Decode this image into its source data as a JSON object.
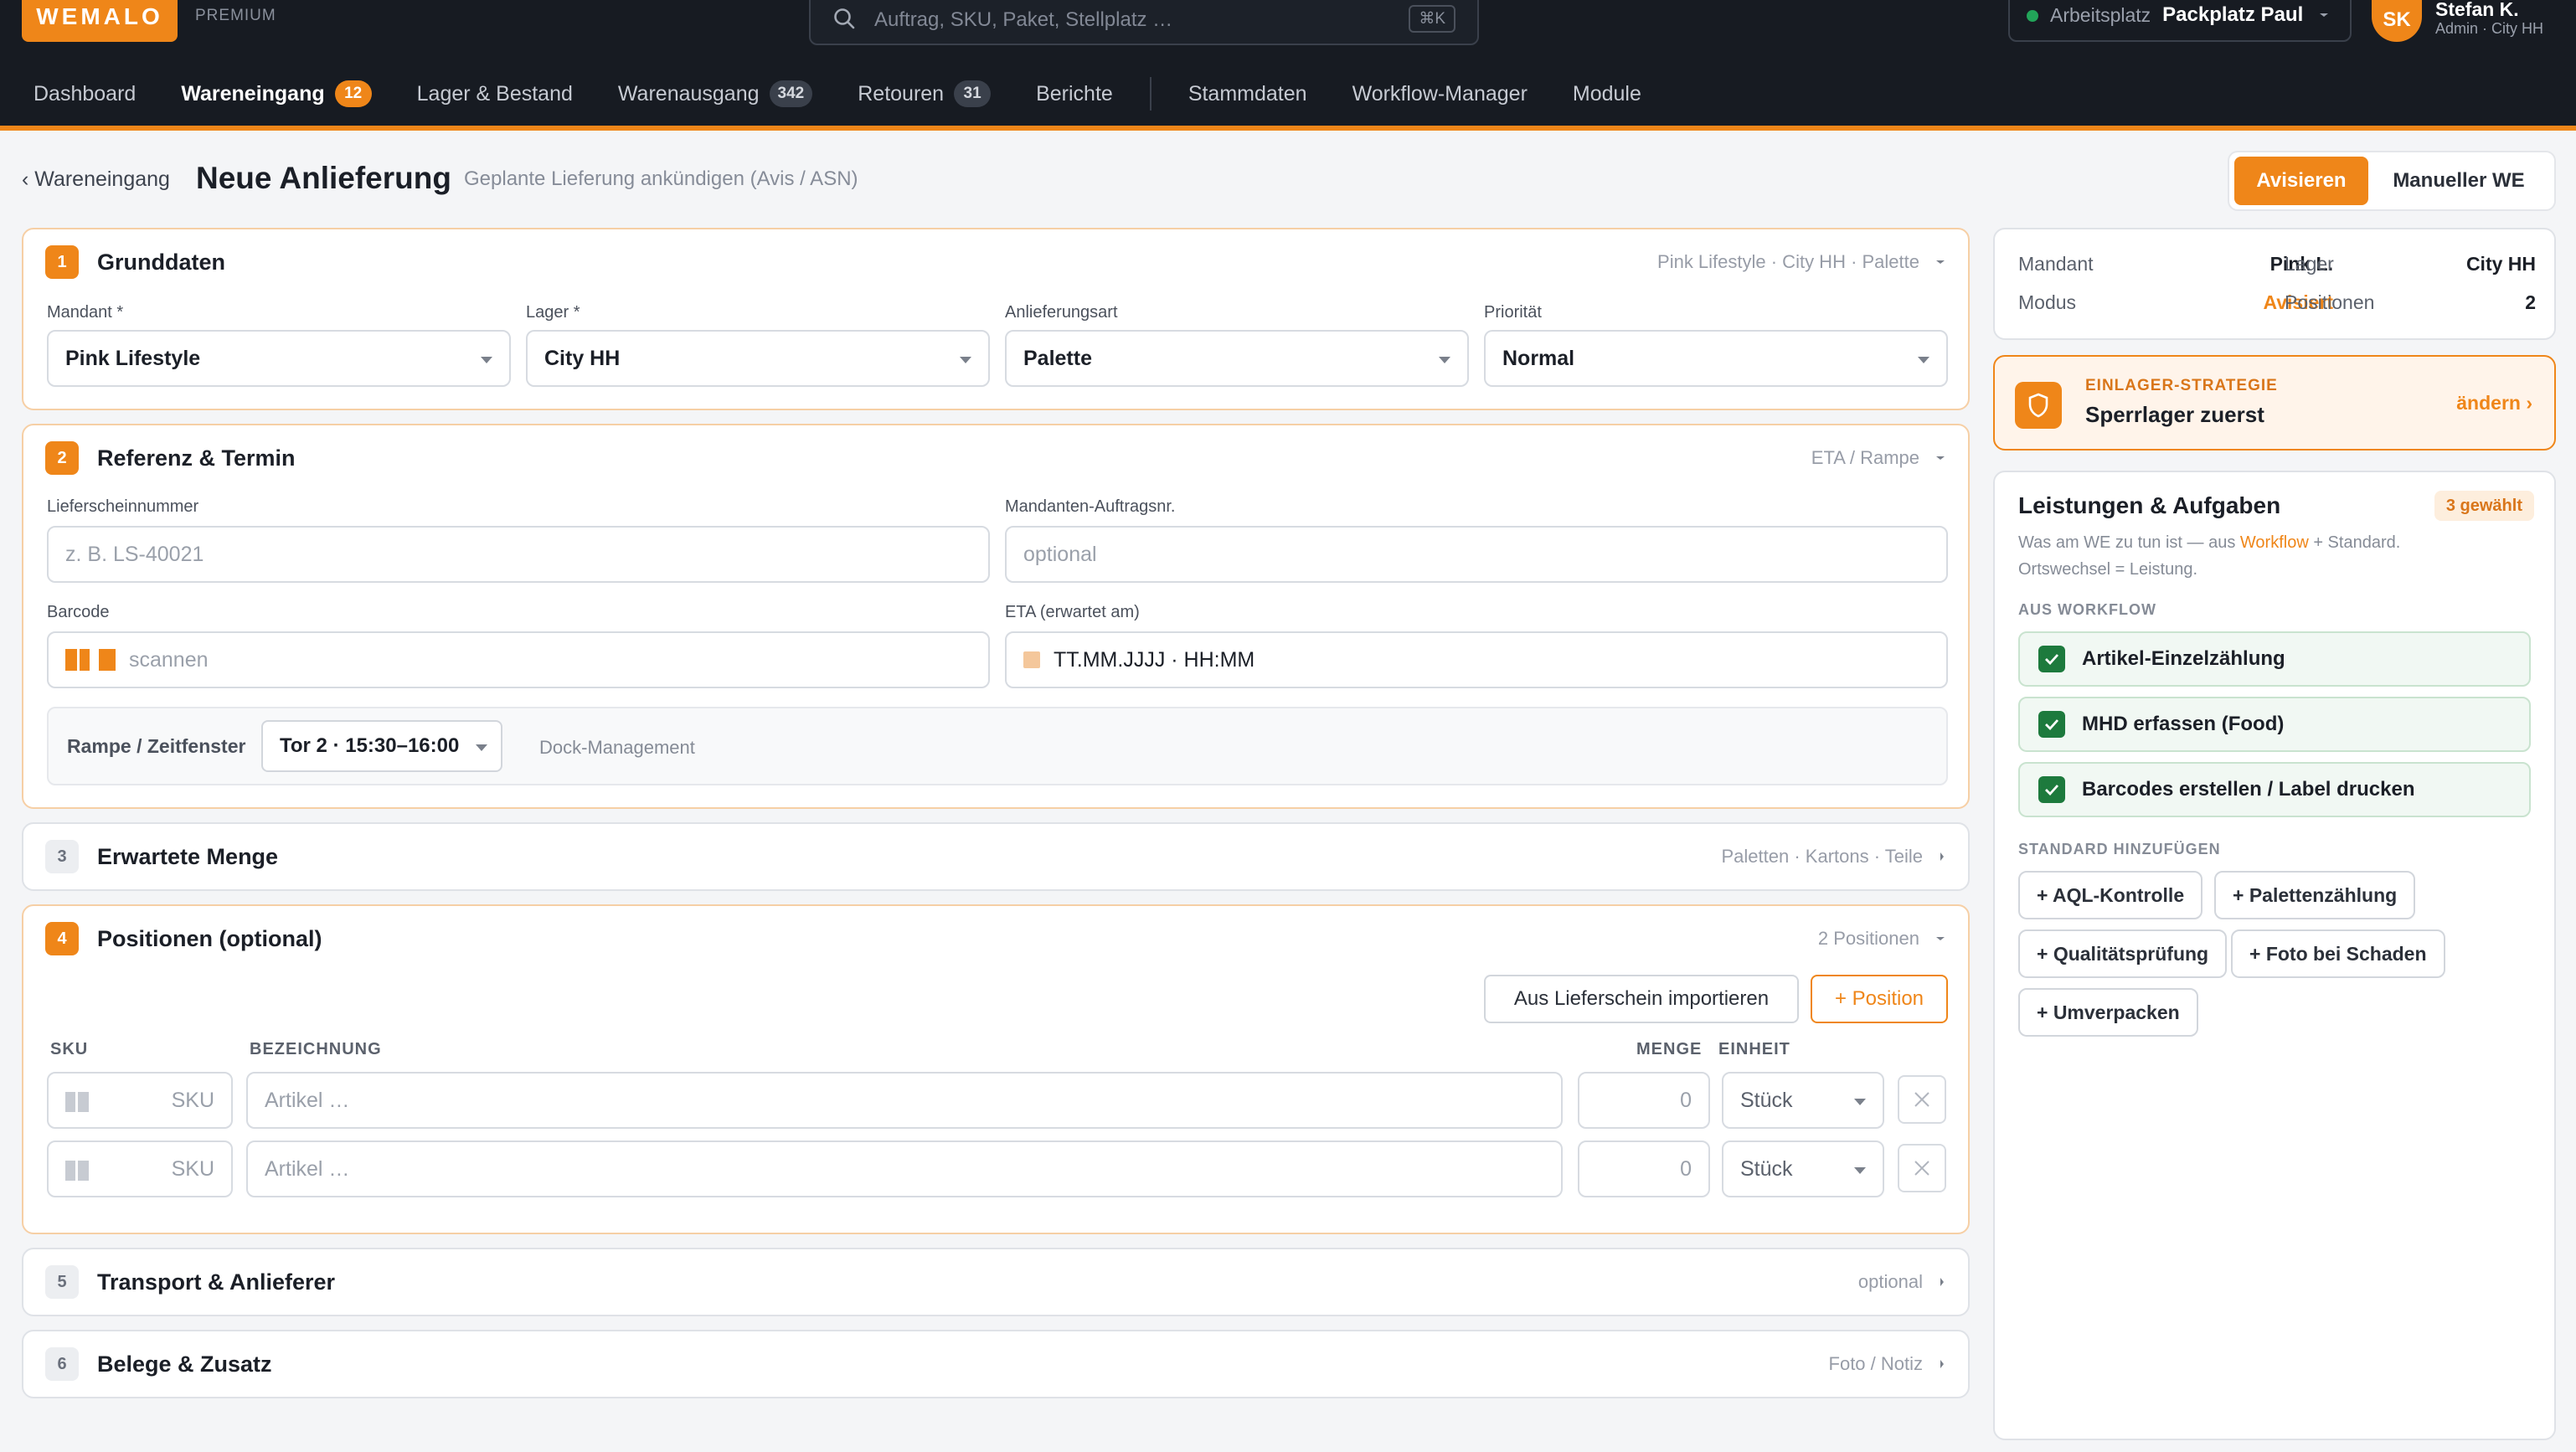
{
  "app": {
    "logo": "WEMALO",
    "plan": "PREMIUM"
  },
  "search": {
    "placeholder": "Auftrag, SKU, Paket, Stellplatz …",
    "shortcut": "⌘K"
  },
  "workspace": {
    "label": "Arbeitsplatz",
    "value": "Packplatz Paul"
  },
  "user": {
    "initials": "SK",
    "name": "Stefan K.",
    "role": "Admin · City HH"
  },
  "nav": [
    {
      "label": "Dashboard"
    },
    {
      "label": "Wareneingang",
      "badge": "12",
      "active": true
    },
    {
      "label": "Lager & Bestand"
    },
    {
      "label": "Warenausgang",
      "badge": "342"
    },
    {
      "label": "Retouren",
      "badge": "31"
    },
    {
      "label": "Berichte"
    },
    {
      "label": "Stammdaten"
    },
    {
      "label": "Workflow-Manager"
    },
    {
      "label": "Module"
    }
  ],
  "header": {
    "back": "‹ Wareneingang",
    "title": "Neue Anlieferung",
    "subtitle": "Geplante Lieferung ankündigen (Avis / ASN)",
    "mode_a": "Avisieren",
    "mode_b": "Manueller WE"
  },
  "s1": {
    "num": "1",
    "title": "Grunddaten",
    "hint": "Pink Lifestyle · City HH · Palette",
    "fields": [
      {
        "label": "Mandant *",
        "value": "Pink Lifestyle"
      },
      {
        "label": "Lager *",
        "value": "City HH"
      },
      {
        "label": "Anlieferungsart",
        "value": "Palette"
      },
      {
        "label": "Priorität",
        "value": "Normal"
      }
    ]
  },
  "s2": {
    "num": "2",
    "title": "Referenz & Termin",
    "hint": "ETA / Rampe",
    "ls_label": "Lieferscheinnummer",
    "ls_placeholder": "z. B. LS-40021",
    "auftrag_label": "Mandanten-Auftragsnr.",
    "auftrag_placeholder": "optional",
    "barcode_label": "Barcode",
    "barcode_placeholder": "scannen",
    "eta_label": "ETA (erwartet am)",
    "eta_value": "TT.MM.JJJJ · HH:MM",
    "ramp_label": "Rampe / Zeitfenster",
    "ramp_value": "Tor 2 · 15:30–16:00",
    "ramp_link": "Dock-Management"
  },
  "s3": {
    "num": "3",
    "title": "Erwartete Menge",
    "hint": "Paletten · Kartons · Teile"
  },
  "s4": {
    "num": "4",
    "title": "Positionen (optional)",
    "hint": "2 Positionen",
    "import_btn": "Aus Lieferschein importieren",
    "add_btn": "+ Position",
    "cols": {
      "sku": "SKU",
      "name": "BEZEICHNUNG",
      "qty": "MENGE",
      "unit": "EINHEIT"
    },
    "rows": [
      {
        "sku": "SKU",
        "name": "Artikel …",
        "qty": "0",
        "unit": "Stück"
      },
      {
        "sku": "SKU",
        "name": "Artikel …",
        "qty": "0",
        "unit": "Stück"
      }
    ]
  },
  "s5": {
    "num": "5",
    "title": "Transport & Anlieferer",
    "hint": "optional"
  },
  "s6": {
    "num": "6",
    "title": "Belege & Zusatz",
    "hint": "Foto / Notiz"
  },
  "summary": {
    "mandant_label": "Mandant",
    "mandant": "Pink L.",
    "lager_label": "Lager",
    "lager": "City HH",
    "modus_label": "Modus",
    "modus": "Avisiert",
    "pos_label": "Positionen",
    "pos": "2"
  },
  "strategy": {
    "label": "EINLAGER-STRATEGIE",
    "value": "Sperrlager zuerst",
    "action": "ändern ›"
  },
  "tasks": {
    "title": "Leistungen & Aufgaben",
    "badge": "3 gewählt",
    "desc_a": "Was am WE zu tun ist — aus ",
    "desc_link": "Workflow",
    "desc_b": " + Standard.",
    "desc_c": "Ortswechsel = Leistung.",
    "wf_label": "AUS WORKFLOW",
    "wf_items": [
      "Artikel-Einzelzählung",
      "MHD erfassen (Food)",
      "Barcodes erstellen / Label drucken"
    ],
    "std_label": "STANDARD HINZUFÜGEN",
    "std_items": [
      "+ AQL-Kontrolle",
      "+ Palettenzählung",
      "+ Qualitätsprüfung",
      "+ Foto bei Schaden",
      "+ Umverpacken"
    ]
  },
  "colors": {
    "accent": "#ef8619",
    "dark": "#171b22",
    "success": "#1d7a3d"
  }
}
